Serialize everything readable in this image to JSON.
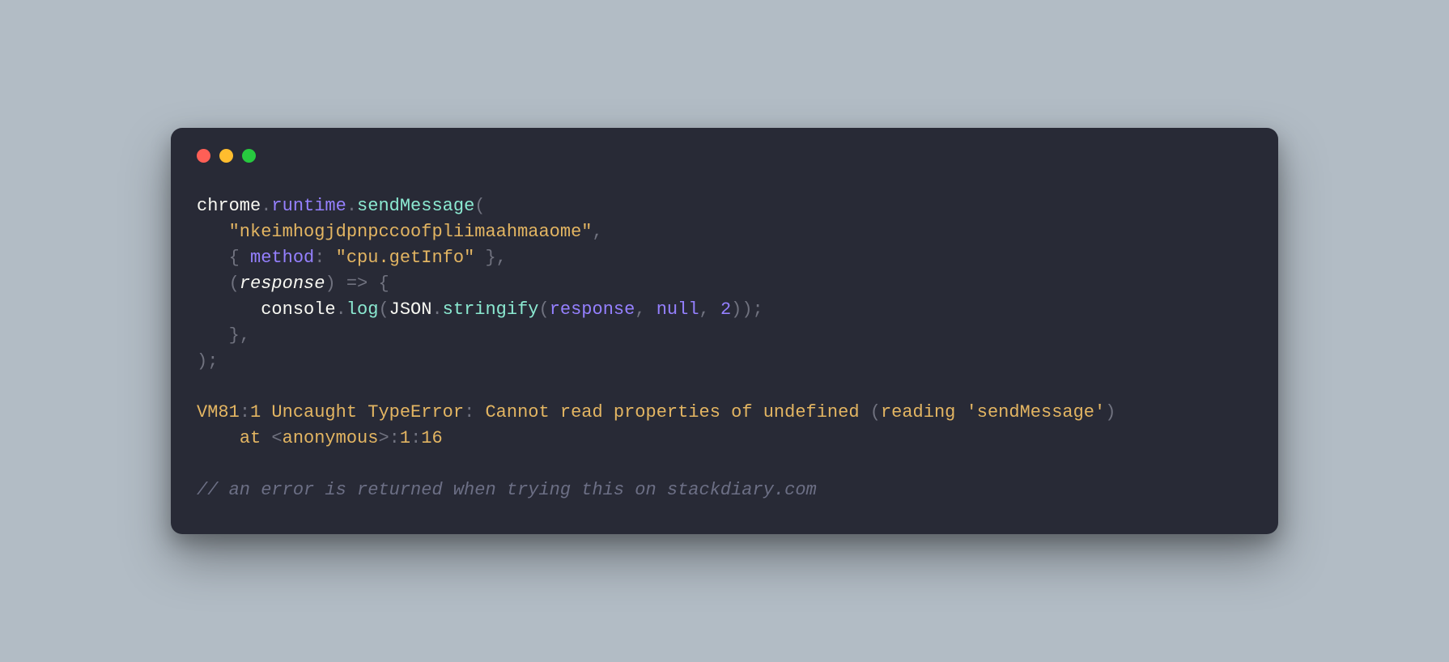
{
  "code": {
    "l1": {
      "a": "chrome",
      "b": ".",
      "c": "runtime",
      "d": ".",
      "e": "sendMessage",
      "f": "("
    },
    "l2": {
      "indent": "   ",
      "a": "\"nkeimhogjdpnpccoofpliimaahmaaome\"",
      "b": ","
    },
    "l3": {
      "indent": "   ",
      "a": "{",
      "b": " method",
      "c": ":",
      "d": " ",
      "e": "\"cpu.getInfo\"",
      "f": " }",
      "g": ","
    },
    "l4": {
      "indent": "   ",
      "a": "(",
      "b": "response",
      "c": ")",
      "d": " ",
      "e": "=>",
      "f": " ",
      "g": "{"
    },
    "l5": {
      "indent": "      ",
      "a": "console",
      "b": ".",
      "c": "log",
      "d": "(",
      "e": "JSON",
      "f": ".",
      "g": "stringify",
      "h": "(",
      "i": "response",
      "j": ",",
      "k": " ",
      "l": "null",
      "m": ",",
      "n": " ",
      "o": "2",
      "p": "));"
    },
    "l6": {
      "indent": "   ",
      "a": "}",
      "b": ","
    },
    "l7": {
      "a": ");"
    },
    "blank1": "",
    "l8": {
      "a": "VM81",
      "b": ":",
      "c": "1",
      "d": " Uncaught TypeError",
      "e": ":",
      "f": " Cannot read properties of undefined ",
      "g": "(",
      "h": "reading ",
      "i": "'sendMessage'",
      "j": ")"
    },
    "l9": {
      "indent": "    ",
      "a": "at ",
      "b": "<",
      "c": "anonymous",
      "d": ">",
      "e": ":",
      "f": "1",
      "g": ":",
      "h": "16"
    },
    "blank2": "",
    "l10": {
      "a": "// an error is returned when trying this on stackdiary.com"
    }
  }
}
